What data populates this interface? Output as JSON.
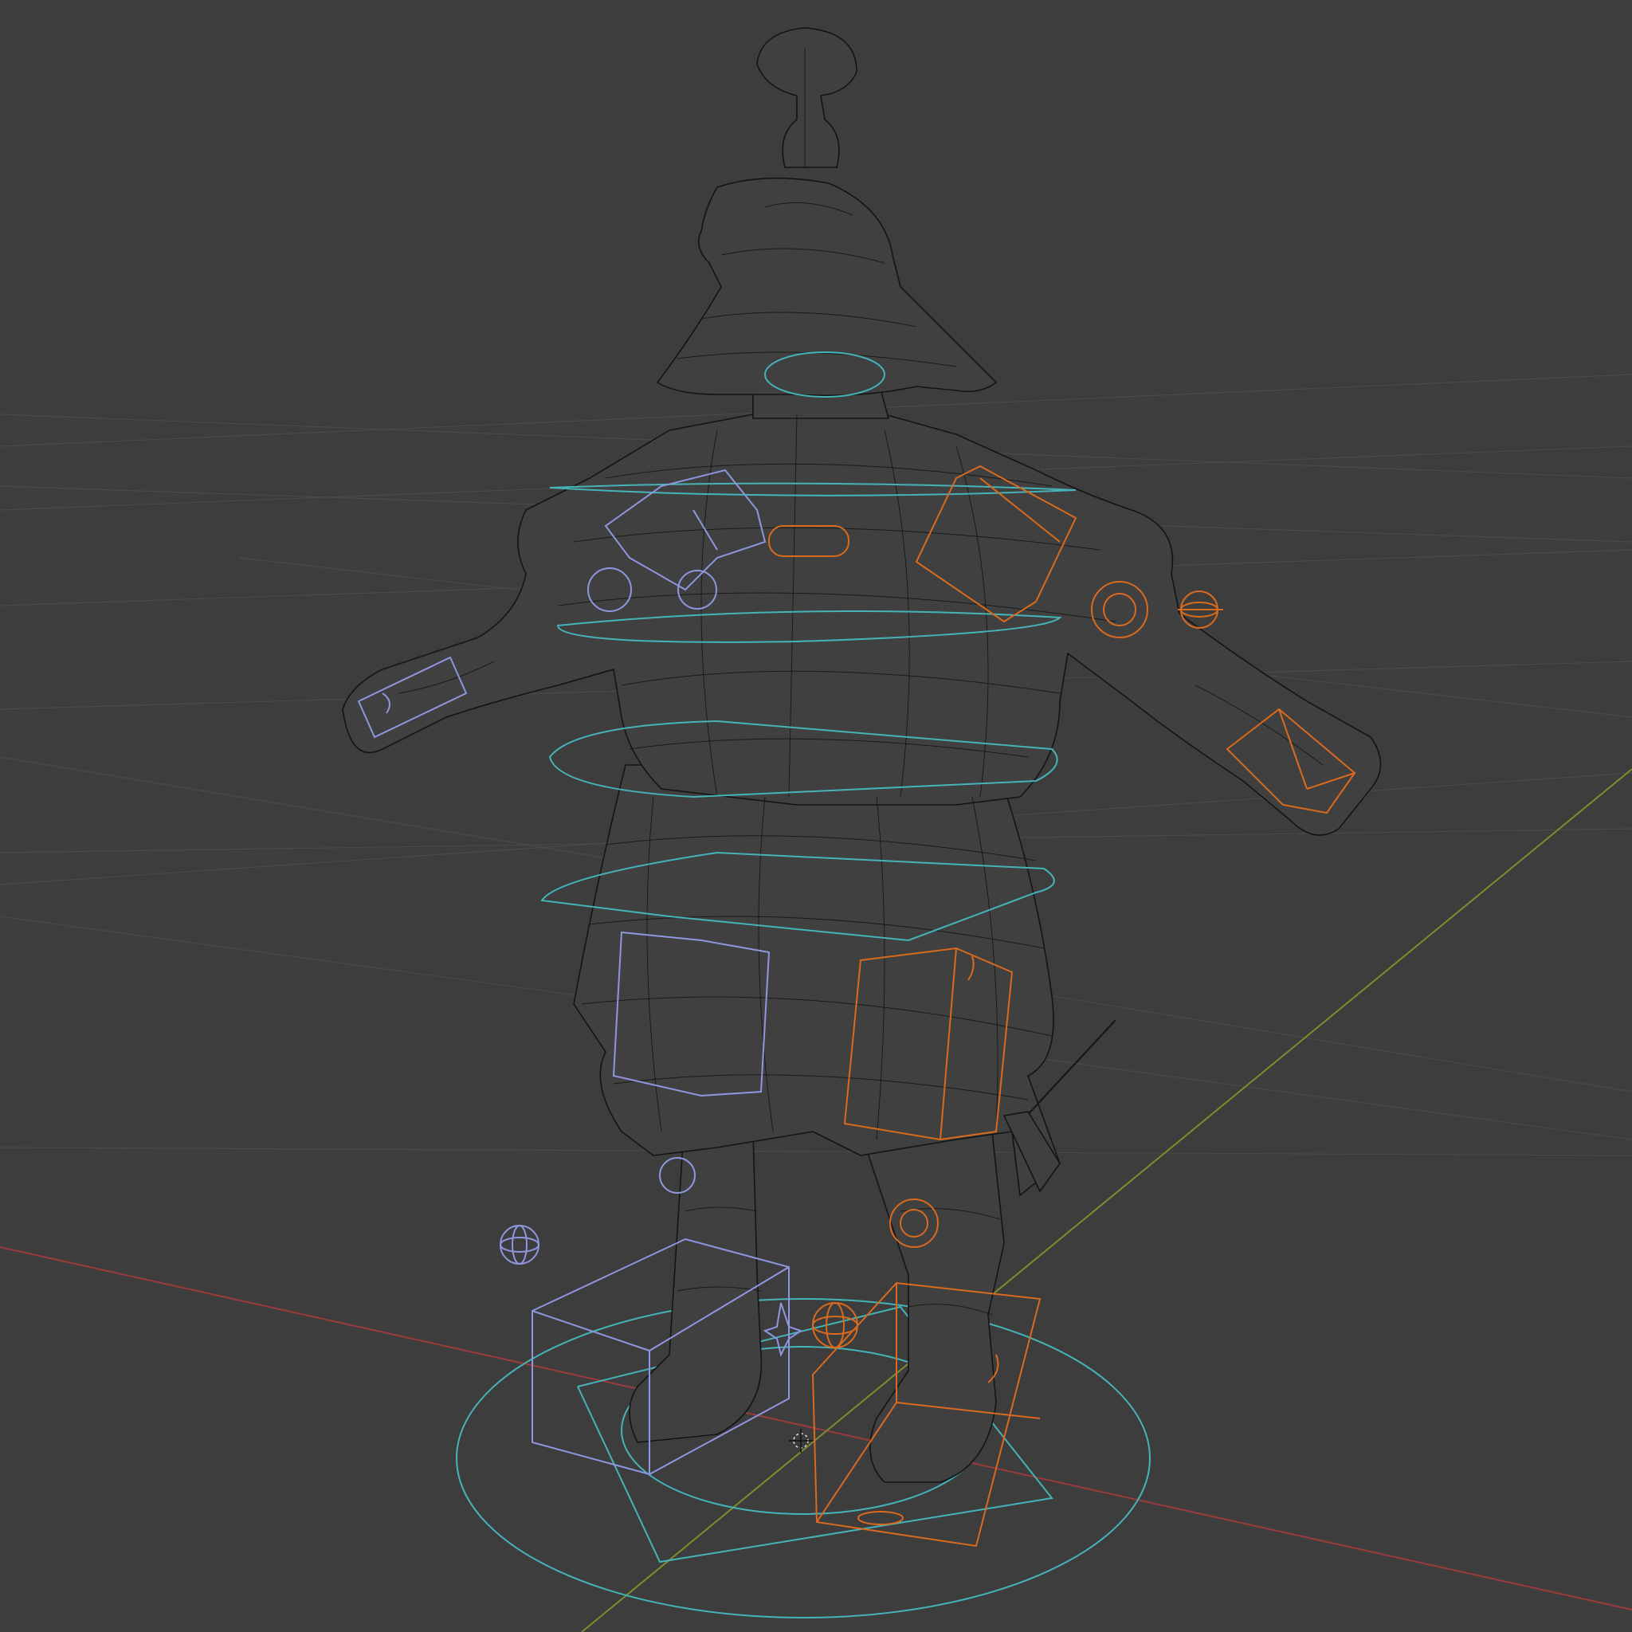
{
  "viewport": {
    "mode": "wireframe",
    "background": "#3d3d3d"
  },
  "colors": {
    "grid": "#4a4a4a",
    "x_axis": "#9b3b3b",
    "y_axis": "#7a8f2c",
    "mesh_wire": "#141414",
    "mesh_fill": "#404040",
    "controls_center": "#45b3b8",
    "controls_left": "#8f96e0",
    "controls_right": "#d96a1e"
  },
  "scene": {
    "character": "samurai-armor-character",
    "rig": "control-rig",
    "pose": "T-pose"
  }
}
